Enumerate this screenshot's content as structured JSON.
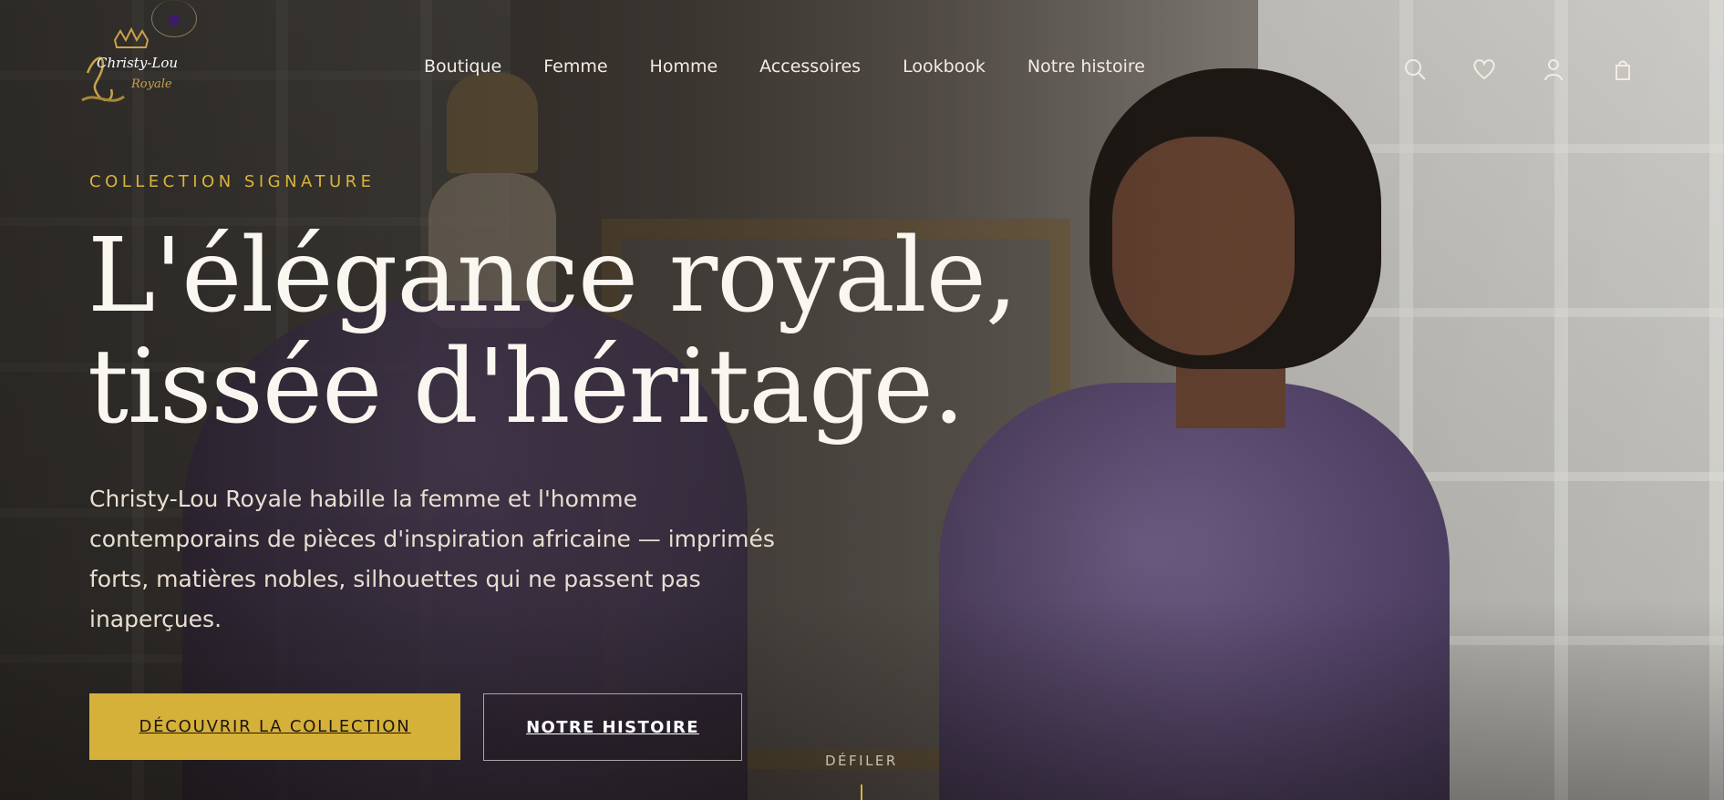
{
  "brand": {
    "logo_text": "Christy-Lou Royale"
  },
  "nav": {
    "items": [
      {
        "label": "Boutique"
      },
      {
        "label": "Femme"
      },
      {
        "label": "Homme"
      },
      {
        "label": "Accessoires"
      },
      {
        "label": "Lookbook"
      },
      {
        "label": "Notre histoire"
      }
    ]
  },
  "header_icons": [
    "search-icon",
    "heart-icon",
    "user-icon",
    "shopping-bag-icon"
  ],
  "hero": {
    "eyebrow": "COLLECTION SIGNATURE",
    "headline_line1": "L'élégance royale,",
    "headline_line2": "tissée d'héritage.",
    "lede": "Christy-Lou Royale habille la femme et l'homme contemporains de pièces d'inspiration africaine — imprimés forts, matières nobles, silhouettes qui ne passent pas inaperçues.",
    "primary_cta": "DÉCOUVRIR LA COLLECTION",
    "secondary_cta": "NOTRE HISTOIRE",
    "scroll_label": "DÉFILER"
  },
  "colors": {
    "accent_gold": "#d6b13a",
    "headline": "#faf6f0",
    "brand_purple": "#3b1b6a"
  }
}
